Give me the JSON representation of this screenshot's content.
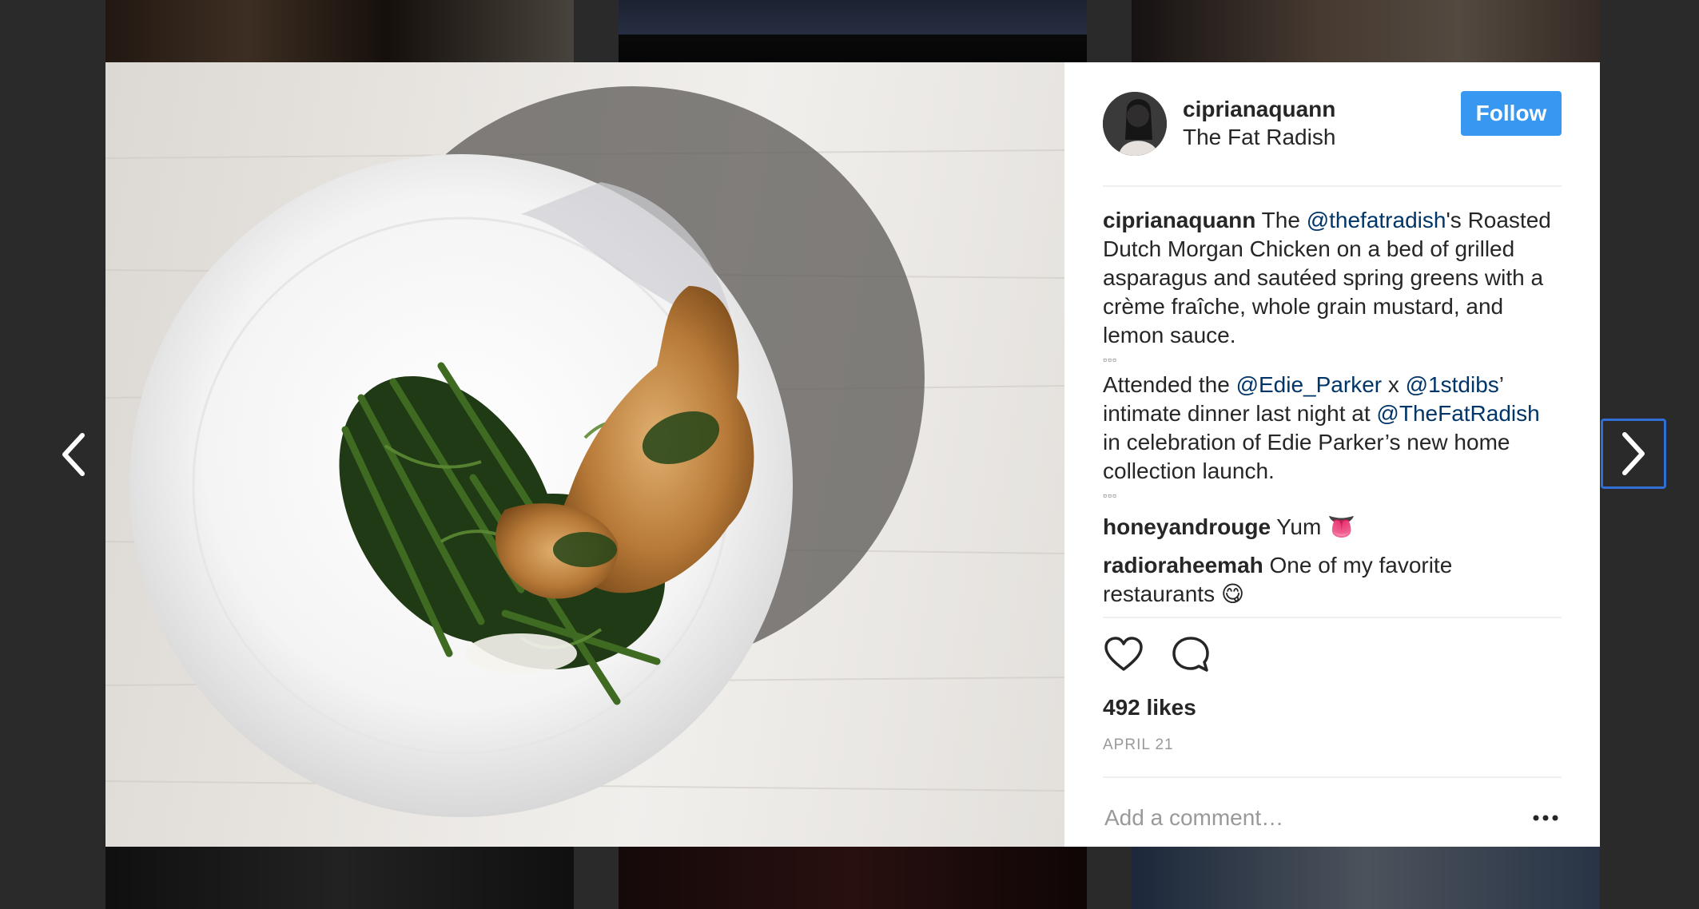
{
  "post": {
    "username": "ciprianaquann",
    "location": "The Fat Radish",
    "follow_label": "Follow",
    "caption": {
      "author": "ciprianaquann",
      "part1": " The ",
      "mention1": "@thefatradish",
      "part2": "'s Roasted Dutch Morgan Chicken on a bed of grilled asparagus and sautéed spring greens with a crème fraîche, whole grain mustard, and lemon sauce.",
      "dots1": "▫▫▫",
      "part3": "Attended the ",
      "mention2": "@Edie_Parker",
      "part4": " x ",
      "mention3": "@1stdibs",
      "part5": "’ intimate dinner last night at ",
      "mention4": "@TheFatRadish",
      "part6": " in celebration of Edie Parker’s new home collection launch.",
      "dots2": "▫▫▫"
    },
    "comments": [
      {
        "author": "honeyandrouge",
        "text": " Yum 👅"
      },
      {
        "author": "radioraheemah",
        "text": " One of my favorite restaurants 😋"
      }
    ],
    "likes": "492 likes",
    "date": "APRIL 21",
    "comment_placeholder": "Add a comment…"
  },
  "icons": {
    "like": "heart-outline-icon",
    "comment": "speech-bubble-icon",
    "more": "more-options-icon",
    "prev": "chevron-left-icon",
    "next": "chevron-right-icon"
  },
  "colors": {
    "follow_button": "#3897f0",
    "mention": "#003569",
    "text": "#262626",
    "muted": "#999999"
  }
}
